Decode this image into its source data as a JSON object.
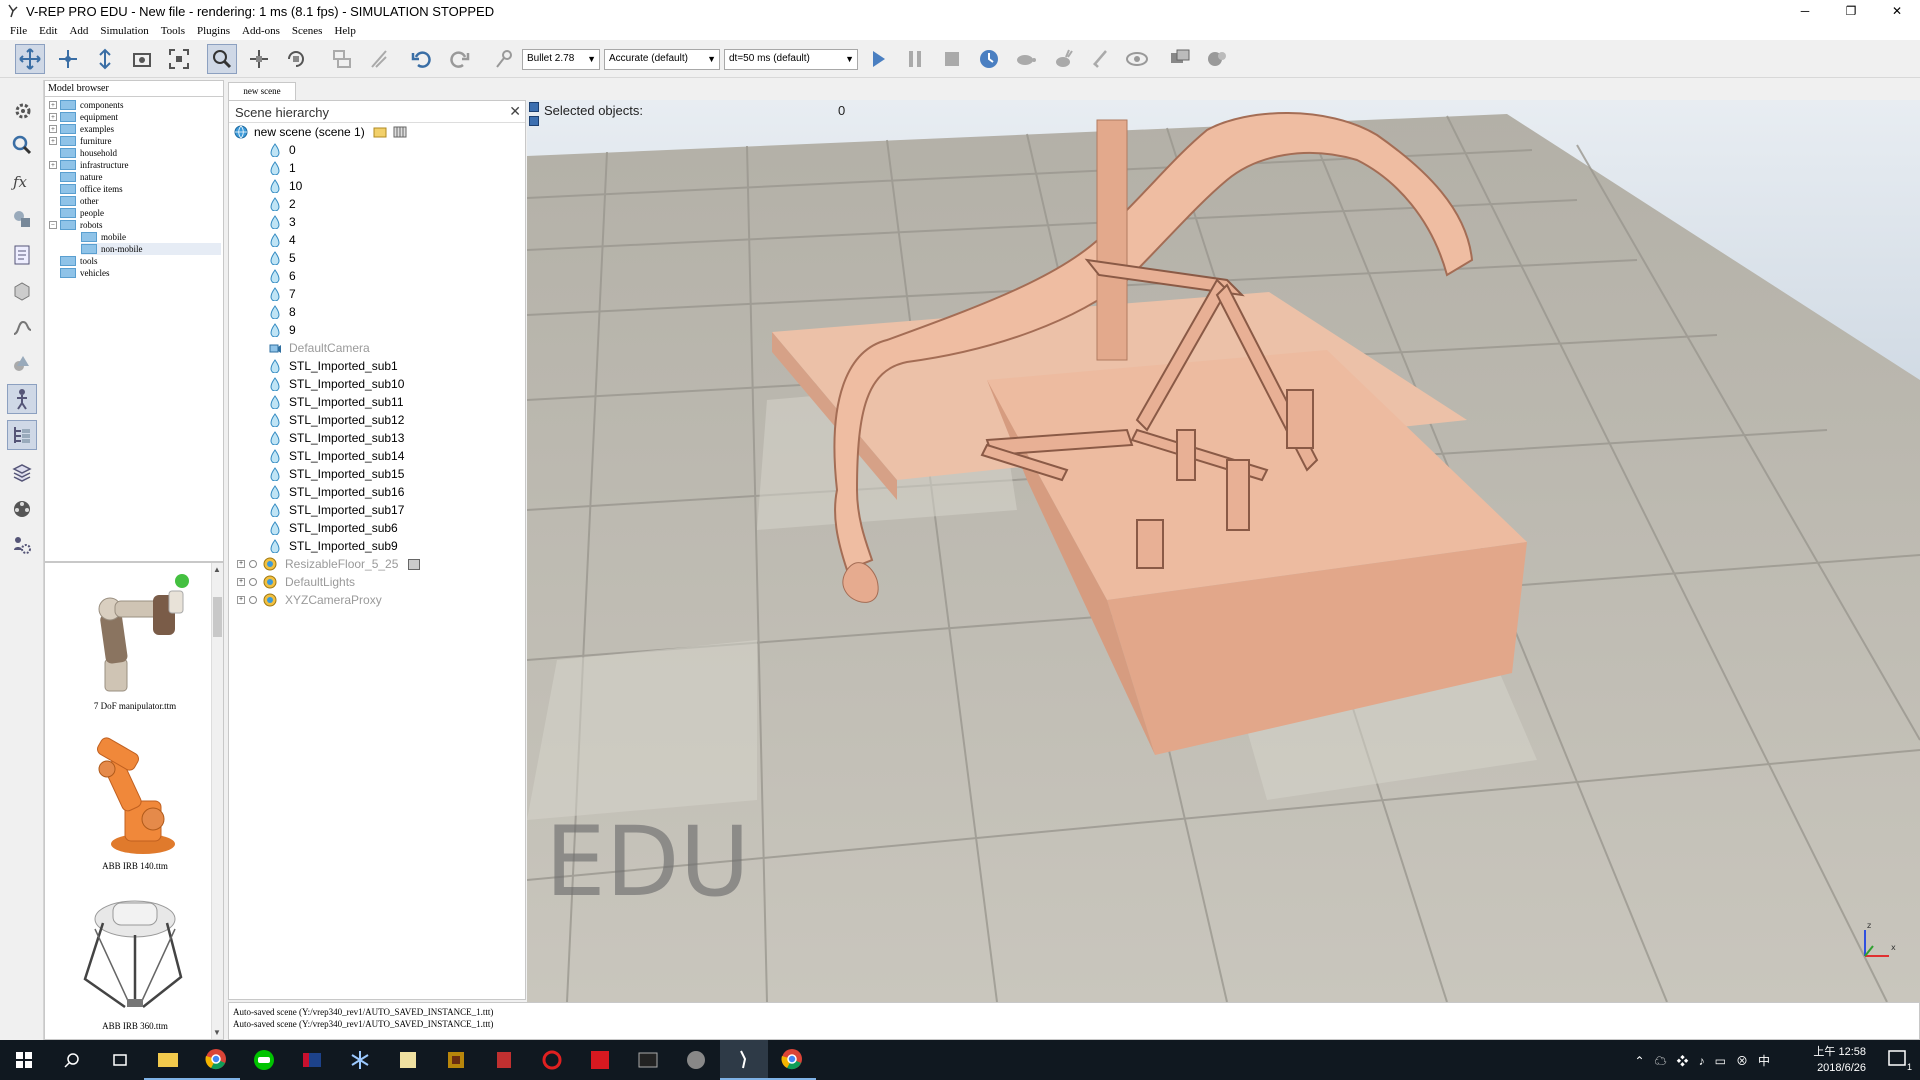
{
  "window": {
    "title": "V-REP PRO EDU - New file - rendering: 1 ms (8.1 fps) - SIMULATION STOPPED",
    "minimize": "─",
    "restore": "❐",
    "close": "✕"
  },
  "menu": [
    "File",
    "Edit",
    "Add",
    "Simulation",
    "Tools",
    "Plugins",
    "Add-ons",
    "Scenes",
    "Help"
  ],
  "toolbar": {
    "engine": "Bullet 2.78",
    "accuracy": "Accurate (default)",
    "timestep": "dt=50 ms (default)"
  },
  "model_browser": {
    "header": "Model browser",
    "items": [
      {
        "label": "components",
        "expandable": true
      },
      {
        "label": "equipment",
        "expandable": true
      },
      {
        "label": "examples",
        "expandable": true
      },
      {
        "label": "furniture",
        "expandable": true
      },
      {
        "label": "household",
        "expandable": false
      },
      {
        "label": "infrastructure",
        "expandable": true
      },
      {
        "label": "nature",
        "expandable": false
      },
      {
        "label": "office items",
        "expandable": false
      },
      {
        "label": "other",
        "expandable": false
      },
      {
        "label": "people",
        "expandable": false
      },
      {
        "label": "robots",
        "expandable": true,
        "expanded": true
      },
      {
        "label": "mobile",
        "expandable": false,
        "child": true
      },
      {
        "label": "non-mobile",
        "expandable": false,
        "child": true,
        "selected": true
      },
      {
        "label": "tools",
        "expandable": false
      },
      {
        "label": "vehicles",
        "expandable": false
      }
    ],
    "thumbnails": [
      {
        "caption": "7 DoF manipulator.ttm"
      },
      {
        "caption": "ABB IRB 140.ttm"
      },
      {
        "caption": "ABB IRB 360.ttm"
      }
    ]
  },
  "scene_tab": "new scene",
  "hierarchy": {
    "header": "Scene hierarchy",
    "close": "✕",
    "root": "new scene (scene 1)",
    "items": [
      {
        "label": "0",
        "dim": false
      },
      {
        "label": "1",
        "dim": false
      },
      {
        "label": "10",
        "dim": false
      },
      {
        "label": "2",
        "dim": false
      },
      {
        "label": "3",
        "dim": false
      },
      {
        "label": "4",
        "dim": false
      },
      {
        "label": "5",
        "dim": false
      },
      {
        "label": "6",
        "dim": false
      },
      {
        "label": "7",
        "dim": false
      },
      {
        "label": "8",
        "dim": false
      },
      {
        "label": "9",
        "dim": false
      },
      {
        "label": "DefaultCamera",
        "dim": true
      },
      {
        "label": "STL_Imported_sub1",
        "dim": false
      },
      {
        "label": "STL_Imported_sub10",
        "dim": false
      },
      {
        "label": "STL_Imported_sub11",
        "dim": false
      },
      {
        "label": "STL_Imported_sub12",
        "dim": false
      },
      {
        "label": "STL_Imported_sub13",
        "dim": false
      },
      {
        "label": "STL_Imported_sub14",
        "dim": false
      },
      {
        "label": "STL_Imported_sub15",
        "dim": false
      },
      {
        "label": "STL_Imported_sub16",
        "dim": false
      },
      {
        "label": "STL_Imported_sub17",
        "dim": false
      },
      {
        "label": "STL_Imported_sub6",
        "dim": false
      },
      {
        "label": "STL_Imported_sub9",
        "dim": false
      }
    ],
    "groups": [
      {
        "label": "ResizableFloor_5_25",
        "dim": true
      },
      {
        "label": "DefaultLights",
        "dim": true
      },
      {
        "label": "XYZCameraProxy",
        "dim": true
      }
    ]
  },
  "viewport": {
    "selected_label": "Selected objects:",
    "selected_count": "0",
    "watermark": "EDU",
    "axis_z": "z",
    "axis_x": "x"
  },
  "status": {
    "lines": [
      "Auto-saved scene (Y:/vrep340_rev1/AUTO_SAVED_INSTANCE_1.ttt)",
      "Auto-saved scene (Y:/vrep340_rev1/AUTO_SAVED_INSTANCE_1.ttt)"
    ]
  },
  "taskbar": {
    "time": "上午 12:58",
    "date": "2018/6/26",
    "notifications": "1"
  },
  "colors": {
    "model": "#e8a888",
    "sky_top": "#b9c9d9",
    "floor": "#b8b5ac"
  }
}
